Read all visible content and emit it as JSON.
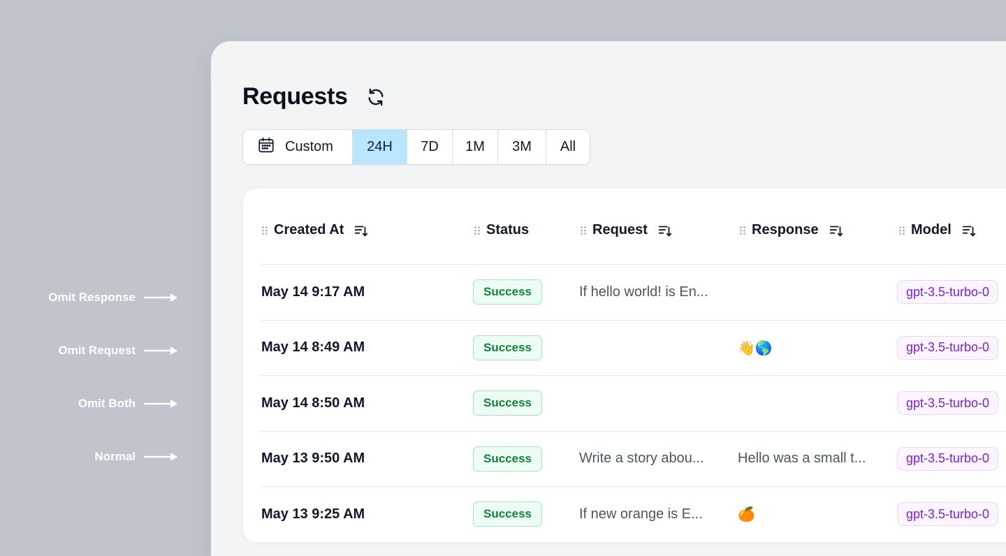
{
  "annotations": [
    {
      "label": "Omit Response"
    },
    {
      "label": "Omit Request"
    },
    {
      "label": "Omit Both"
    },
    {
      "label": "Normal"
    }
  ],
  "header": {
    "title": "Requests",
    "refresh_icon": "refresh-icon"
  },
  "range_filter": {
    "custom_label": "Custom",
    "calendar_icon": "calendar-icon",
    "options": [
      "24H",
      "7D",
      "1M",
      "3M",
      "All"
    ],
    "selected": "24H",
    "active_color": "#bae6fd"
  },
  "table": {
    "columns": {
      "created_at": "Created At",
      "status": "Status",
      "request": "Request",
      "response": "Response",
      "model": "Model"
    },
    "rows": [
      {
        "created_at": "May 14 9:17 AM",
        "status": "Success",
        "request": "If hello world! is En...",
        "response": "",
        "model": "gpt-3.5-turbo-0"
      },
      {
        "created_at": "May 14 8:49 AM",
        "status": "Success",
        "request": "",
        "response": "👋🌎",
        "model": "gpt-3.5-turbo-0"
      },
      {
        "created_at": "May 14 8:50 AM",
        "status": "Success",
        "request": "",
        "response": "",
        "model": "gpt-3.5-turbo-0"
      },
      {
        "created_at": "May 13 9:50 AM",
        "status": "Success",
        "request": "Write a story abou...",
        "response": "Hello was a small t...",
        "model": "gpt-3.5-turbo-0"
      },
      {
        "created_at": "May 13 9:25 AM",
        "status": "Success",
        "request": "If new orange is E...",
        "response": "🍊",
        "model": "gpt-3.5-turbo-0"
      }
    ]
  },
  "colors": {
    "success_text": "#15803d",
    "success_bg": "#ecfdf3",
    "model_text": "#7e22ce",
    "model_bg": "#faf5ff"
  }
}
